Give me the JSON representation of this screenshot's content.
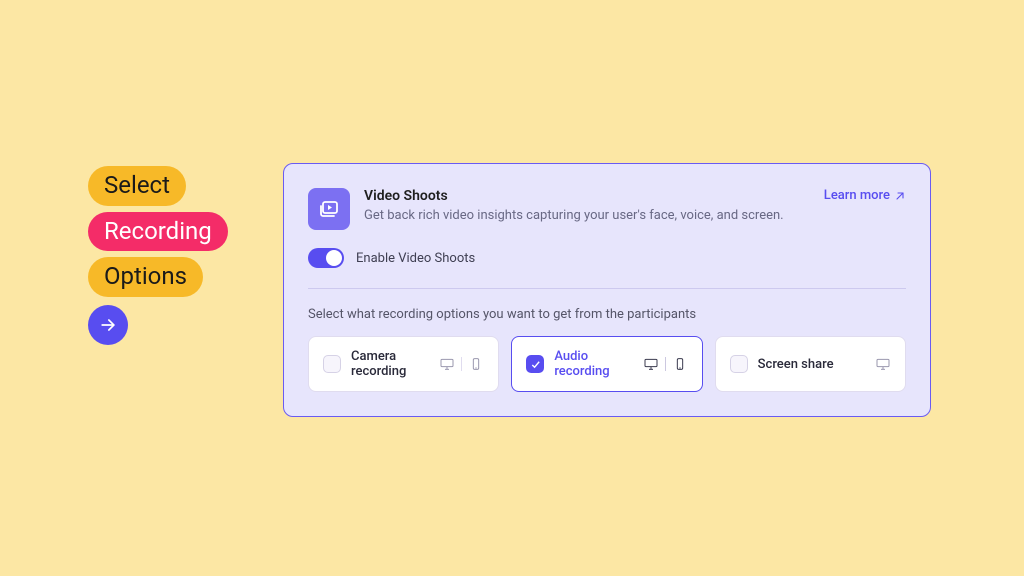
{
  "pills": [
    "Select",
    "Recording",
    "Options"
  ],
  "card": {
    "title": "Video Shoots",
    "description": "Get back rich video insights capturing your user's face, voice, and screen.",
    "learn_more": "Learn more",
    "toggle_label": "Enable Video Shoots",
    "section_label": "Select what recording options you want to get from the participants",
    "options": [
      {
        "label": "Camera recording",
        "checked": false,
        "devices": [
          "desktop",
          "mobile"
        ]
      },
      {
        "label": "Audio recording",
        "checked": true,
        "devices": [
          "desktop",
          "mobile"
        ]
      },
      {
        "label": "Screen share",
        "checked": false,
        "devices": [
          "desktop"
        ]
      }
    ]
  }
}
